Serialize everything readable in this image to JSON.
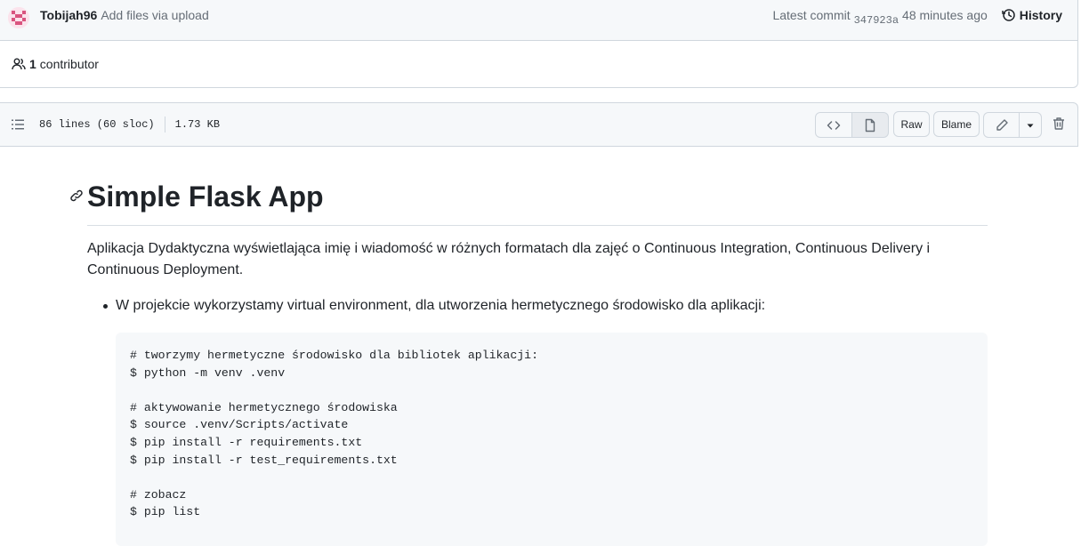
{
  "commit": {
    "author": "Tobijah96",
    "message": "Add files via upload",
    "latest_label": "Latest commit",
    "sha": "347923a",
    "time": "48 minutes ago",
    "history_label": "History"
  },
  "contributors": {
    "count": "1",
    "label": "contributor"
  },
  "file": {
    "lines": "86 lines (60 sloc)",
    "size": "1.73 KB",
    "raw_label": "Raw",
    "blame_label": "Blame"
  },
  "readme": {
    "title": "Simple Flask App",
    "intro": "Aplikacja Dydaktyczna wyświetlająca imię i wiadomość w różnych formatach dla zajęć o Continuous Integration, Continuous Delivery i Continuous Deployment.",
    "bullet": "W projekcie wykorzystamy virtual environment, dla utworzenia hermetycznego środowisko dla aplikacji:",
    "code_lines": [
      "# tworzymy hermetyczne środowisko dla bibliotek aplikacji:",
      "$ python -m venv .venv",
      "",
      "# aktywowanie hermetycznego środowiska",
      "$ source .venv/Scripts/activate",
      "$ pip install -r requirements.txt",
      "$ pip install -r test_requirements.txt",
      "",
      "# zobacz",
      "$ pip list"
    ]
  }
}
